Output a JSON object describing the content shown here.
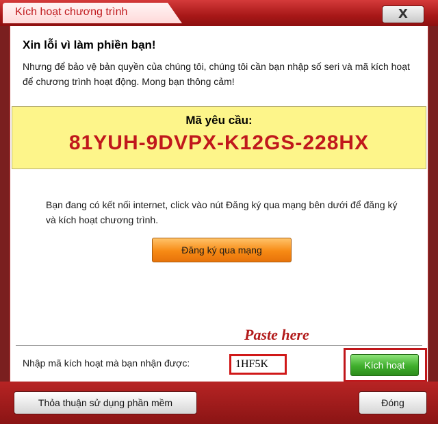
{
  "window": {
    "title": "Kích hoạt chương trình",
    "close_label": "X"
  },
  "content": {
    "heading": "Xin lỗi vì làm phiền bạn!",
    "intro": "Nhưng để bảo vệ bản quyền của chúng tôi, chúng tôi cần bạn nhập số seri và mã kích hoạt để chương trình hoạt động. Mong bạn thông cảm!",
    "request_code_label": "Mã yêu cầu:",
    "request_code": "81YUH-9DVPX-K12GS-228HX",
    "internet_text": "Bạn đang có kết nối internet, click vào nút Đăng ký qua mạng bên dưới để đăng ký và kích hoạt chương trình.",
    "register_button": "Đăng ký qua mạng",
    "paste_hint": "Paste here",
    "activation_label": "Nhập mã kích hoạt mà bạn nhận được:",
    "activation_value": "1HF5K",
    "activate_button": "Kích hoạt"
  },
  "footer": {
    "terms_button": "Thỏa thuận sử dụng phần mềm",
    "close_button": "Đóng"
  }
}
